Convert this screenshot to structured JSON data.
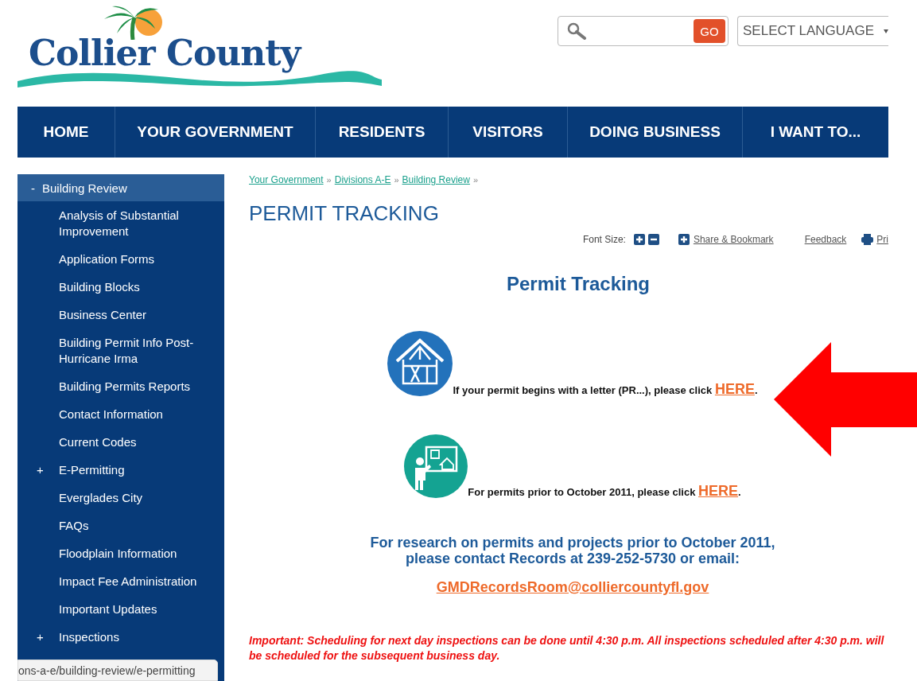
{
  "header": {
    "logo_text": "Collier County",
    "go_button": "GO",
    "language_select": "SELECT LANGUAGE"
  },
  "nav": [
    {
      "label": "HOME"
    },
    {
      "label": "YOUR GOVERNMENT"
    },
    {
      "label": "RESIDENTS"
    },
    {
      "label": "VISITORS"
    },
    {
      "label": "DOING BUSINESS"
    },
    {
      "label": "I WANT TO..."
    }
  ],
  "sidebar": {
    "header": {
      "toggle": "-",
      "label": "Building Review",
      "selected": true
    },
    "items": [
      {
        "label": "Analysis of Substantial Improvement",
        "selected": false
      },
      {
        "label": "Application Forms",
        "selected": false
      },
      {
        "label": "Building Blocks",
        "selected": false
      },
      {
        "label": "Business Center",
        "selected": false
      },
      {
        "label": "Building Permit Info Post-Hurricane Irma",
        "selected": false
      },
      {
        "label": "Building Permits Reports",
        "selected": false
      },
      {
        "label": "Contact Information",
        "selected": false
      },
      {
        "label": "Current Codes",
        "selected": false
      },
      {
        "toggle": "+",
        "label": "E-Permitting",
        "selected": false
      },
      {
        "label": "Everglades City",
        "selected": false
      },
      {
        "label": "FAQs",
        "selected": false
      },
      {
        "label": "Floodplain Information",
        "selected": false
      },
      {
        "label": "Impact Fee Administration",
        "selected": false
      },
      {
        "label": "Important Updates",
        "selected": false
      },
      {
        "toggle": "+",
        "label": "Inspections",
        "selected": false
      }
    ]
  },
  "breadcrumb": [
    {
      "label": "Your Government",
      "separator": "»"
    },
    {
      "label": "Divisions A-E",
      "separator": "»"
    },
    {
      "label": "Building Review",
      "separator": "»"
    }
  ],
  "page_title": "PERMIT TRACKING",
  "tools": {
    "font_size_label": "Font Size:",
    "share": "Share & Bookmark",
    "feedback": "Feedback",
    "print": "Pri"
  },
  "heading": "Permit Tracking",
  "options": [
    {
      "kind": "house",
      "text": "If your permit begins with a letter (PR...), please click ",
      "link": "HERE",
      "after": "."
    },
    {
      "kind": "presenter",
      "text": "For permits prior to October 2011, please click ",
      "link": "HERE",
      "after": "."
    }
  ],
  "research": [
    "For research on permits and projects prior to October 2011,",
    "please contact Records at 239-252-5730 or email:"
  ],
  "email": "GMDRecordsRoom@colliercountyfl.gov",
  "notice": "Important: Scheduling for next day inspections can be done until 4:30 p.m. All inspections scheduled after 4:30 p.m. will be scheduled for the subsequent business day.",
  "status_url": "ons-a-e/building-review/e-permitting"
}
